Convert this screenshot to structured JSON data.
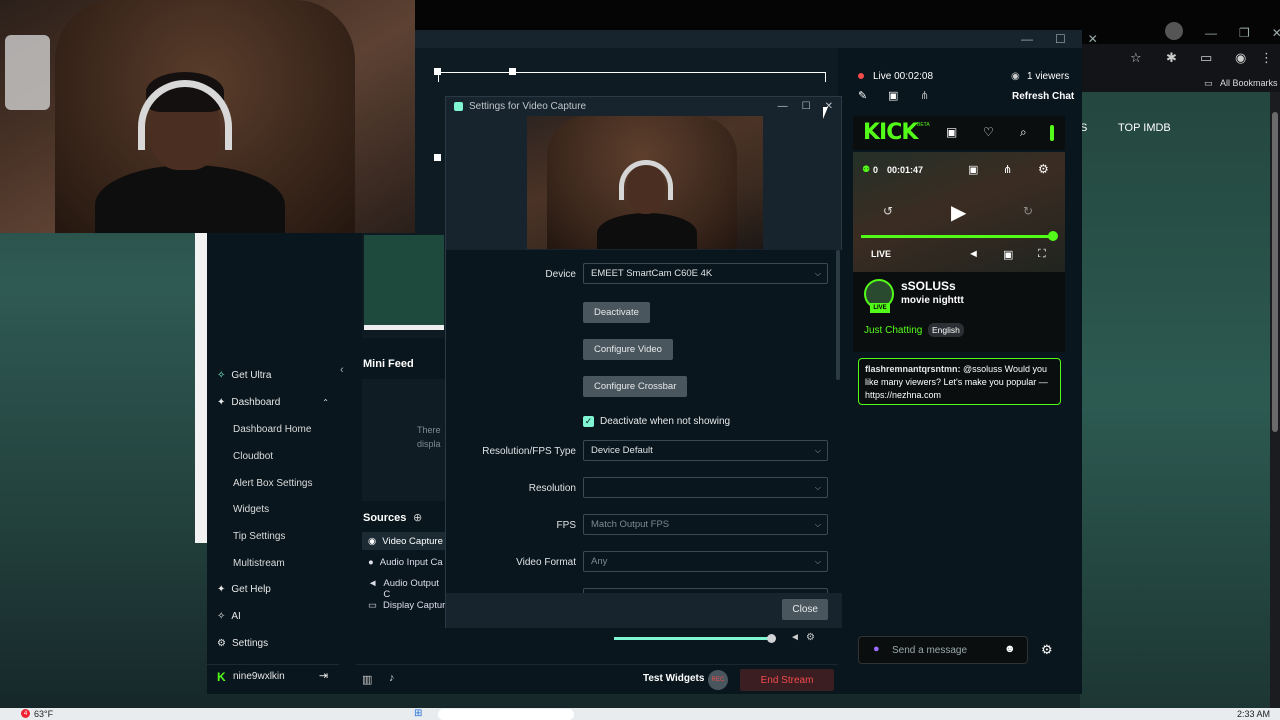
{
  "browser": {
    "bookmarks_label": "All Bookmarks",
    "page_nav_text": "TOP IMDB",
    "page_nav_partial": "S"
  },
  "webcam": {},
  "dialog": {
    "title": "Settings for Video Capture",
    "device_label": "Device",
    "device_value": "EMEET SmartCam C60E 4K",
    "deactivate_button": "Deactivate",
    "configure_video_button": "Configure Video",
    "configure_crossbar_button": "Configure Crossbar",
    "deactivate_checkbox_label": "Deactivate when not showing",
    "resolution_fps_type_label": "Resolution/FPS Type",
    "resolution_fps_type_value": "Device Default",
    "resolution_label": "Resolution",
    "resolution_value": "",
    "fps_label": "FPS",
    "fps_value": "Match Output FPS",
    "video_format_label": "Video Format",
    "video_format_value": "Any",
    "close_button": "Close"
  },
  "sidebar": {
    "get_ultra": "Get Ultra",
    "dashboard": "Dashboard",
    "sub_items": [
      "Dashboard Home",
      "Cloudbot",
      "Alert Box Settings",
      "Widgets",
      "Tip Settings",
      "Multistream"
    ],
    "get_help": "Get Help",
    "ai": "AI",
    "settings": "Settings",
    "username": "nine9wxlkin"
  },
  "mini_feed": {
    "title": "Mini Feed",
    "empty_line1": "There",
    "empty_line2": "displa"
  },
  "sources": {
    "title": "Sources",
    "items": [
      "Video Capture",
      "Audio Input Ca",
      "Audio Output C",
      "Display Captur"
    ]
  },
  "bottom_bar": {
    "test_widgets": "Test Widgets",
    "rec": "REC",
    "end_stream": "End Stream"
  },
  "live_panel": {
    "live_status": "Live 00:02:08",
    "viewers": "1 viewers",
    "refresh_chat": "Refresh Chat"
  },
  "kick": {
    "logo": "KICK",
    "beta": "BETA",
    "viewer_count": "0",
    "elapsed": "00:01:47",
    "live_label": "LIVE",
    "streamer": "sSOLUSs",
    "stream_title": "movie nighttt",
    "category": "Just Chatting",
    "language": "English",
    "avatar_badge": "LIVE",
    "chat_user": "flashremnantqrsntmn:",
    "chat_text": "@ssoluss Would you like many viewers? Let's make you popular — https://nezhna.com",
    "message_placeholder": "Send a message"
  },
  "taskbar": {
    "weather": "63°F",
    "notif_count": "4",
    "time": "2:33 AM"
  },
  "colors": {
    "kick_green": "#53fc18",
    "end_stream_red": "#f44b4b",
    "streamlabs_bg": "#09161d",
    "checkbox_teal": "#80f5d2"
  }
}
